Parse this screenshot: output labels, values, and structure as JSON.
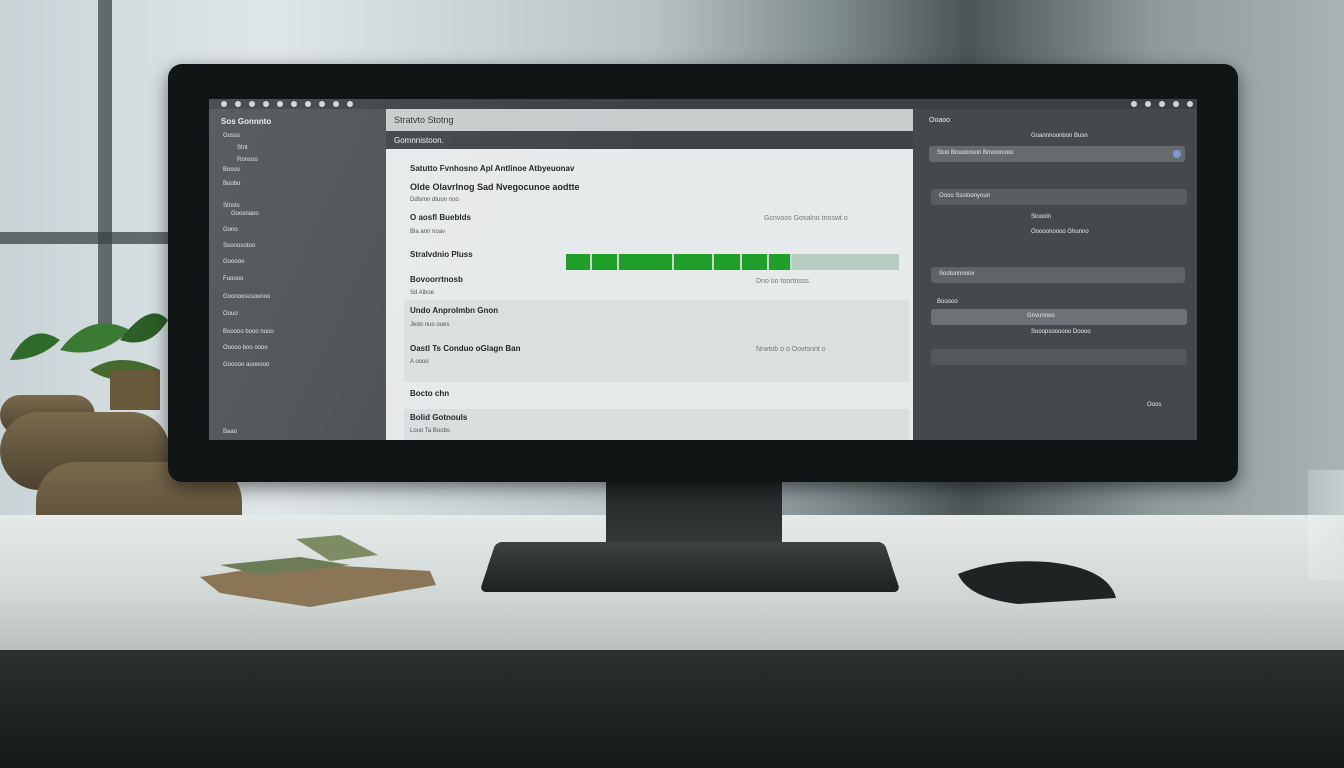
{
  "main": {
    "title": "Stratvto Stotng",
    "subtitle": "Gomnnistoon.",
    "headline1": "Satutto Fvnhosno Apl Antlinoe Atbyeuonav",
    "headline2": "Olde Olavrlnog Sad Nvegocunoe aodtte",
    "headline2_sub": "Ddlsmn dtuon noo",
    "section1_title": "O aosfl Bueblds",
    "section1_sub": "Bla ann noav",
    "section1_right": "Gcnvoos  Gosalno tnoswt o",
    "progress_label": "Stralvdnio Pluss",
    "progress_fraction": 0.8,
    "section2_title": "Bovoorrtnosb",
    "section2_sub": "Sd Alboe",
    "section2_right": "Dno oo toortnsss",
    "section3_title": "Undo Anprolmbn Gnon",
    "section3_sub": "Jedo nuo oues",
    "section4_title": "Oastl  Ts Conduo oGlagn Ban",
    "section4_sub": "A oooo",
    "section4_right": "Nrwtob  o o Oovtsnnt  o",
    "section5_title": "Bocto chn",
    "section6_title": "Bolid Gotnouls",
    "section6_sub": "Louo Ta Boobs"
  },
  "sidebar": {
    "heading": "Sos  Gonnnto",
    "items": [
      "Gosss",
      "Stnt",
      "Ronsoo",
      "Booos",
      "Boobo",
      "Stnsts",
      "Goosnaoo",
      "Gono",
      "Soonosotoo",
      "Gooooo",
      "Fuoooo",
      "Goonoosusoonoo",
      "Oouo",
      "Booooo  booo  nuoo",
      "Ooooo boo oooo",
      "Gooooo aoooooo",
      "Baao"
    ]
  },
  "right_panel": {
    "heading": "Ooaoo",
    "rows": [
      "Stoo  Bnuoooson  Bnvoonooo",
      "Goannnoonbon Busn",
      "Oooo   Ssstoonyoun",
      "Sloooln",
      "Ooooonoooo Ghunno",
      "Sootunnnoov",
      "Booooo",
      "Gnvunnoo",
      "Sooopsoooooo Doooo"
    ],
    "footer": "Ooos"
  }
}
